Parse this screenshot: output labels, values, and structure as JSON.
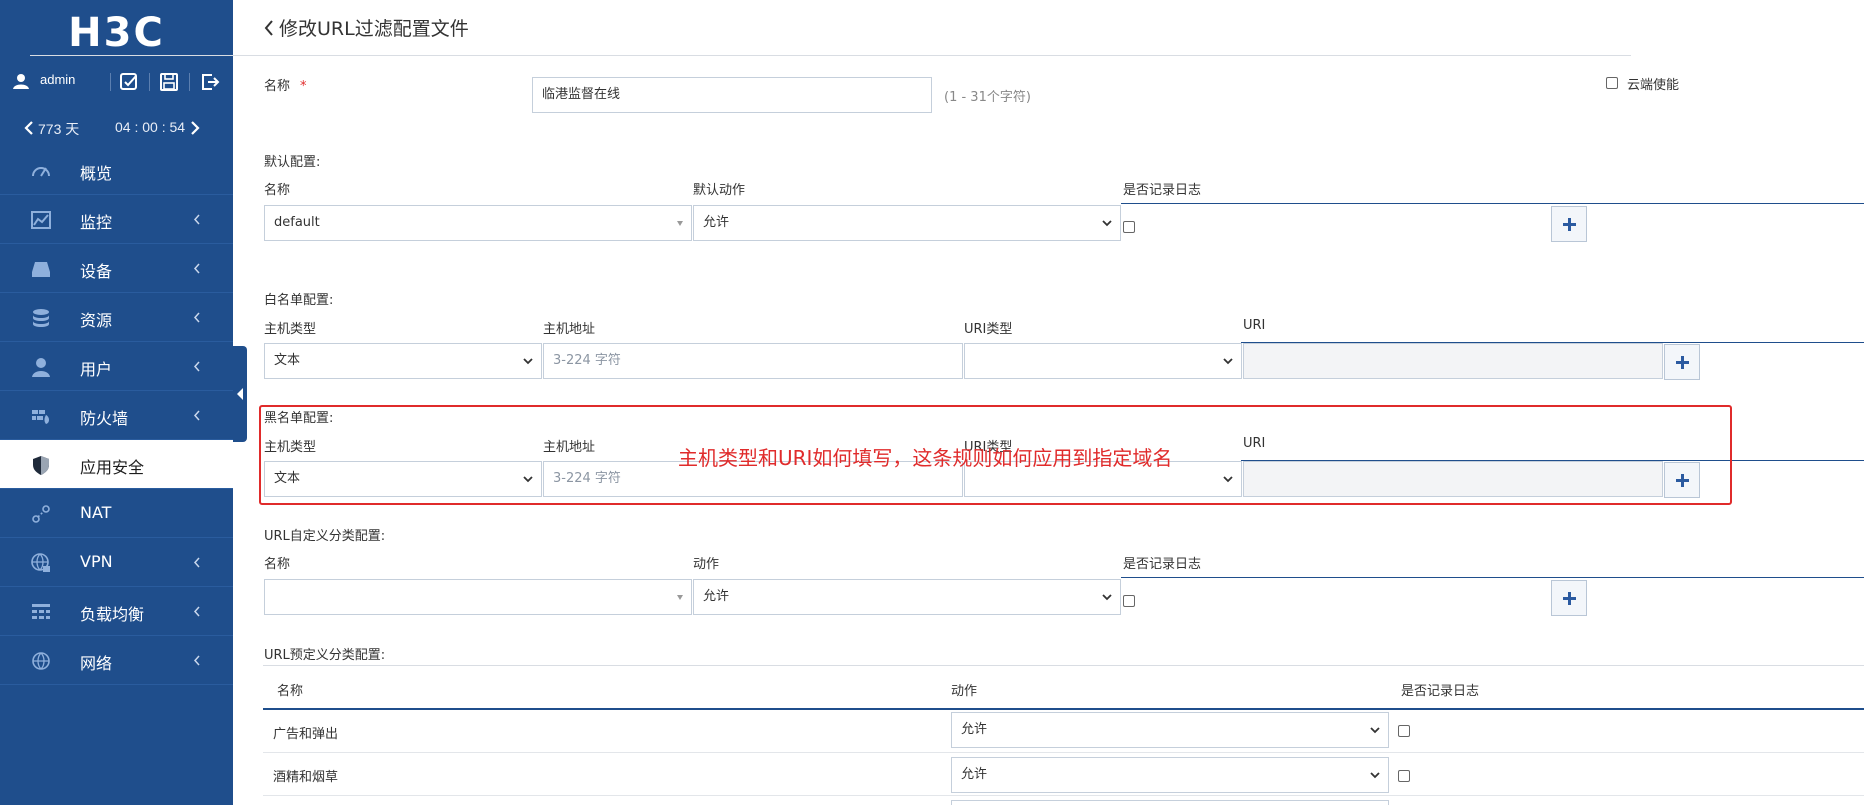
{
  "brand": {
    "logo_text": "H3C"
  },
  "userbar": {
    "username": "admin"
  },
  "uptime": {
    "days": "773 天",
    "clock": "04 : 00 : 54"
  },
  "sidebar": {
    "items": [
      {
        "label": "概览",
        "icon": "gauge-icon",
        "has_submenu": false
      },
      {
        "label": "监控",
        "icon": "monitor-chart-icon",
        "has_submenu": true
      },
      {
        "label": "设备",
        "icon": "device-icon",
        "has_submenu": true
      },
      {
        "label": "资源",
        "icon": "database-icon",
        "has_submenu": true
      },
      {
        "label": "用户",
        "icon": "user-icon",
        "has_submenu": true
      },
      {
        "label": "防火墙",
        "icon": "firewall-icon",
        "has_submenu": true
      },
      {
        "label": "应用安全",
        "icon": "shield-icon",
        "has_submenu": false,
        "active": true
      },
      {
        "label": "NAT",
        "icon": "nat-icon",
        "has_submenu": false
      },
      {
        "label": "VPN",
        "icon": "globe-lock-icon",
        "has_submenu": true
      },
      {
        "label": "负载均衡",
        "icon": "load-balance-icon",
        "has_submenu": true
      },
      {
        "label": "网络",
        "icon": "globe-icon",
        "has_submenu": true
      }
    ]
  },
  "page": {
    "title": "修改URL过滤配置文件"
  },
  "form": {
    "name_label": "名称",
    "required_mark": "*",
    "name_value": "临港监督在线",
    "name_hint": "(1 - 31个字符)",
    "cloud_label": "云端使能"
  },
  "default_config": {
    "section_label": "默认配置:",
    "col_name": "名称",
    "col_action": "默认动作",
    "col_log": "是否记录日志",
    "name_value": "default",
    "action_value": "允许"
  },
  "whitelist": {
    "section_label": "白名单配置:",
    "col_host_type": "主机类型",
    "col_host_addr": "主机地址",
    "col_uri_type": "URI类型",
    "col_uri": "URI",
    "host_type_value": "文本",
    "host_addr_placeholder": "3-224 字符"
  },
  "blacklist": {
    "section_label": "黑名单配置:",
    "col_host_type": "主机类型",
    "col_host_addr": "主机地址",
    "col_uri_type": "URI类型",
    "col_uri": "URI",
    "host_type_value": "文本",
    "host_addr_placeholder": "3-224 字符"
  },
  "annotation": {
    "text": "主机类型和URI如何填写，这条规则如何应用到指定域名",
    "color": "#e02b2b"
  },
  "custom_category": {
    "section_label": "URL自定义分类配置:",
    "col_name": "名称",
    "col_action": "动作",
    "col_log": "是否记录日志",
    "action_value": "允许"
  },
  "predefined_category": {
    "section_label": "URL预定义分类配置:",
    "col_name": "名称",
    "col_action": "动作",
    "col_log": "是否记录日志",
    "rows": [
      {
        "name": "广告和弹出",
        "action": "允许"
      },
      {
        "name": "酒精和烟草",
        "action": "允许"
      }
    ]
  },
  "colors": {
    "sidebar_bg": "#1f4e8c",
    "accent": "#2b5aa0",
    "annotation_red": "#e02b2b"
  }
}
